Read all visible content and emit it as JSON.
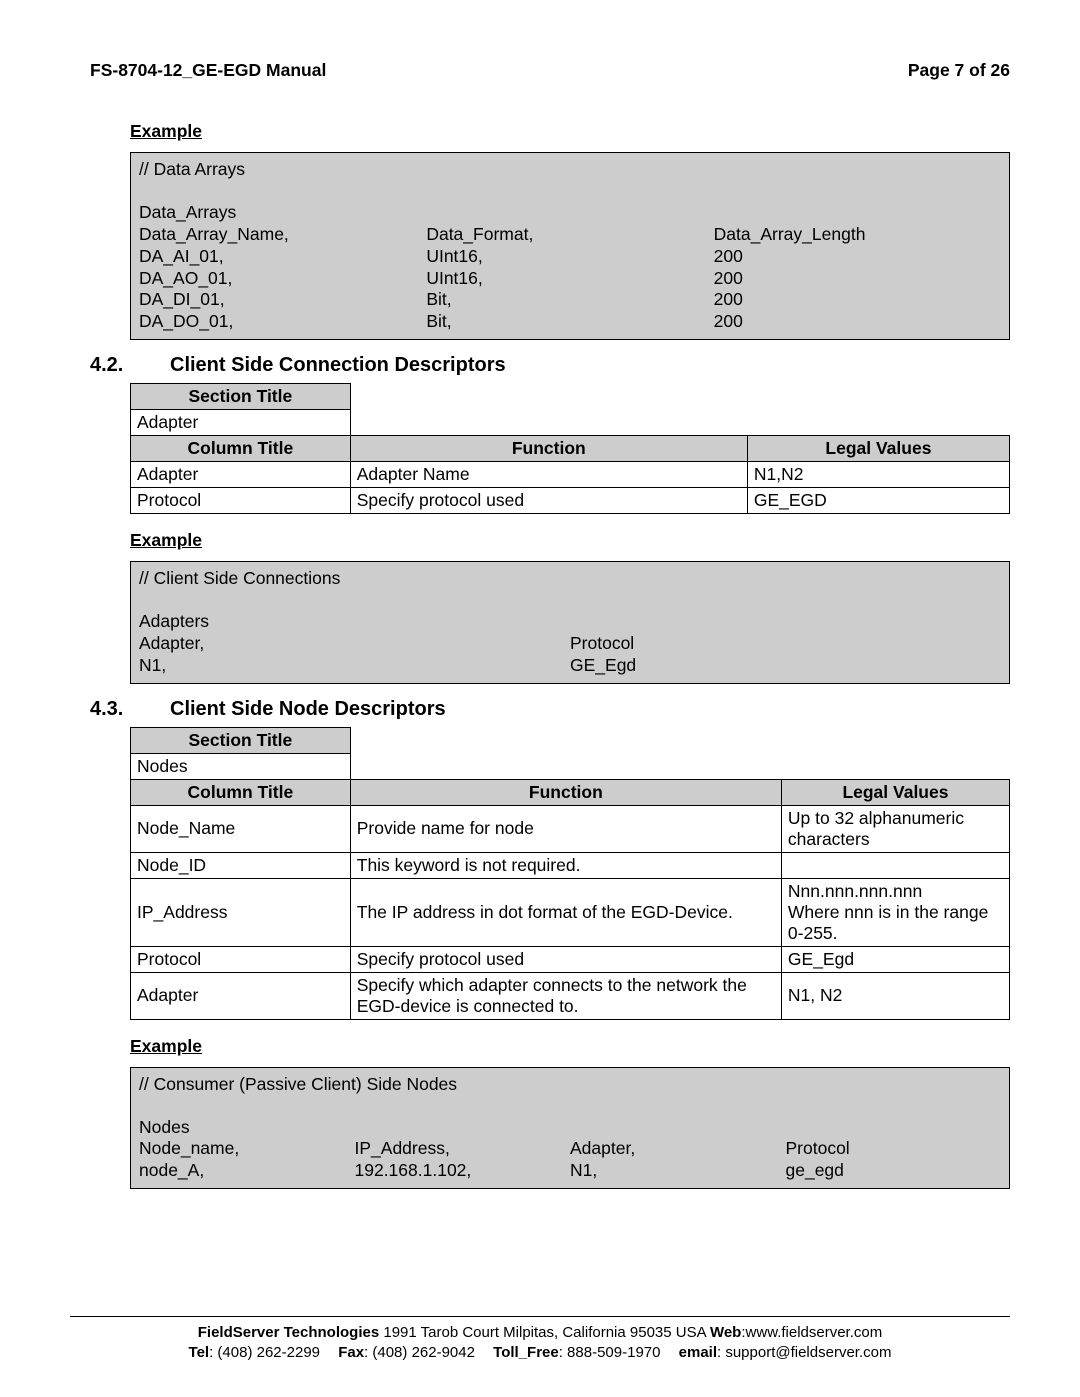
{
  "header": {
    "left": "FS-8704-12_GE-EGD Manual",
    "right": "Page 7 of 26"
  },
  "labels": {
    "example": "Example",
    "section_title": "Section Title",
    "column_title": "Column Title",
    "function": "Function",
    "legal_values": "Legal Values"
  },
  "example1": {
    "comment": "//    Data Arrays",
    "declare": "Data_Arrays",
    "header": {
      "c1": "Data_Array_Name,",
      "c2": "Data_Format,",
      "c3": "Data_Array_Length"
    },
    "rows": [
      {
        "c1": "DA_AI_01,",
        "c2": "UInt16,",
        "c3": "200"
      },
      {
        "c1": "DA_AO_01,",
        "c2": "UInt16,",
        "c3": "200"
      },
      {
        "c1": "DA_DI_01,",
        "c2": "Bit,",
        "c3": "200"
      },
      {
        "c1": "DA_DO_01,",
        "c2": "Bit,",
        "c3": "200"
      }
    ]
  },
  "sec42": {
    "num": "4.2.",
    "title": "Client Side Connection Descriptors",
    "section_value": "Adapter",
    "rows": [
      {
        "col": "Adapter",
        "func": "Adapter Name",
        "legal": "N1,N2"
      },
      {
        "col": "Protocol",
        "func": "Specify protocol used",
        "legal": "GE_EGD"
      }
    ]
  },
  "example2": {
    "comment": "//    Client Side Connections",
    "declare": "Adapters",
    "header": {
      "c1": "Adapter,",
      "c2": "Protocol"
    },
    "rows": [
      {
        "c1": "N1,",
        "c2": "GE_Egd"
      }
    ]
  },
  "sec43": {
    "num": "4.3.",
    "title": "Client Side Node Descriptors",
    "section_value": "Nodes",
    "rows": [
      {
        "col": "Node_Name",
        "func": "Provide name for node",
        "legal": "Up to 32 alphanumeric characters"
      },
      {
        "col": "Node_ID",
        "func": "This keyword is not required.",
        "legal": ""
      },
      {
        "col": "IP_Address",
        "func": "The IP address in dot format of the EGD-Device.",
        "legal": "Nnn.nnn.nnn.nnn\nWhere nnn is in the range 0-255."
      },
      {
        "col": "Protocol",
        "func": "Specify protocol used",
        "legal": "GE_Egd"
      },
      {
        "col": "Adapter",
        "func": "Specify which adapter connects to the network the EGD-device is connected to.",
        "legal": "N1, N2"
      }
    ]
  },
  "example3": {
    "comment": "//    Consumer (Passive Client) Side Nodes",
    "declare": "Nodes",
    "header": {
      "c1": "Node_name,",
      "c2": "IP_Address,",
      "c3": "Adapter,",
      "c4": "Protocol"
    },
    "rows": [
      {
        "c1": "node_A,",
        "c2": "192.168.1.102,",
        "c3": "N1,",
        "c4": "ge_egd"
      }
    ]
  },
  "footer": {
    "company_bold": "FieldServer Technologies",
    "address": " 1991 Tarob Court Milpitas, California 95035 USA ",
    "web_label": "Web",
    "web_value": ":www.fieldserver.com",
    "tel_label": "Tel",
    "tel_value": ": (408) 262-2299",
    "fax_label": "Fax",
    "fax_value": ": (408) 262-9042",
    "tollfree_label": "Toll_Free",
    "tollfree_value": ": 888-509-1970",
    "email_label": "email",
    "email_value": ": support@fieldserver.com"
  }
}
